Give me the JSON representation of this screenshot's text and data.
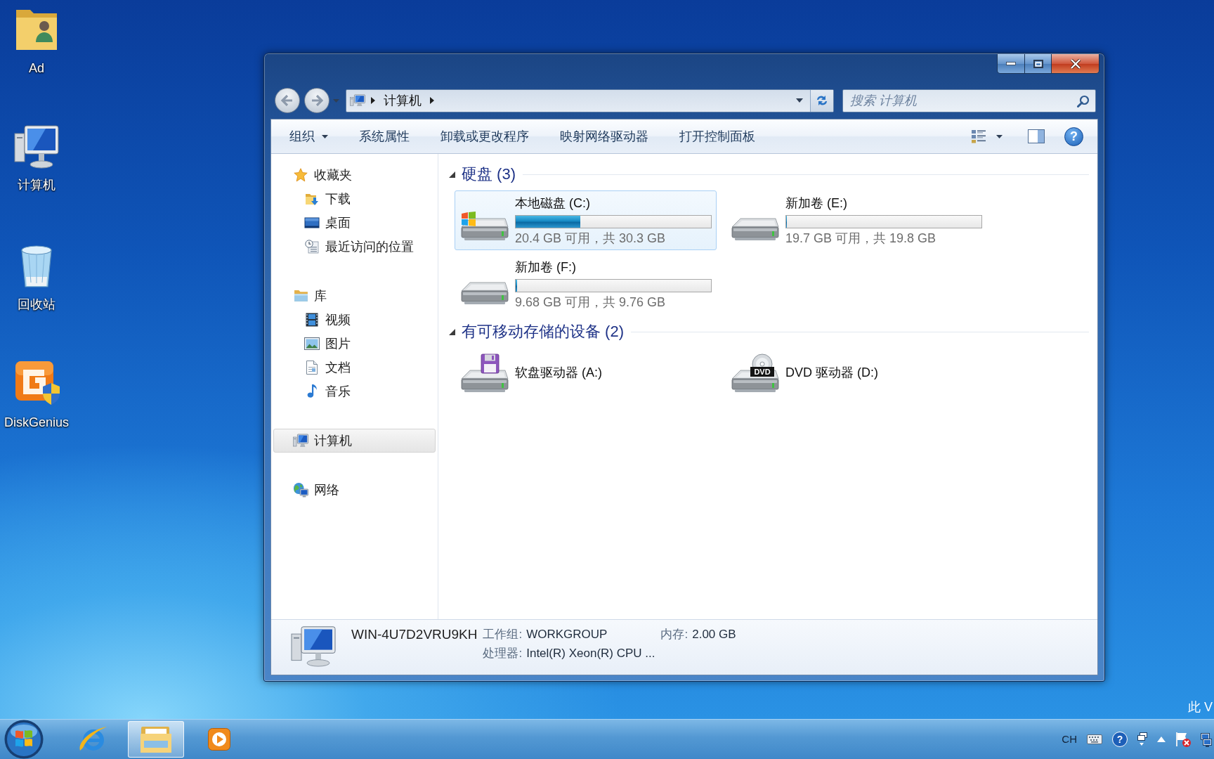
{
  "desktop": {
    "icons": [
      {
        "kind": "user-folder",
        "label": "Ad"
      },
      {
        "kind": "computer",
        "label": "计算机"
      },
      {
        "kind": "recycle-bin",
        "label": "回收站"
      },
      {
        "kind": "disk-tool",
        "label": "DiskGenius"
      }
    ],
    "corner_text": "此 V"
  },
  "window": {
    "navigation": {
      "back": {
        "disabled": true
      },
      "forward": {
        "disabled": true
      }
    },
    "address": {
      "path": [
        "计算机"
      ]
    },
    "search": {
      "placeholder": "搜索 计算机"
    }
  },
  "toolbar": {
    "items": [
      {
        "kind": "menu",
        "label": "组织"
      },
      {
        "kind": "command",
        "label": "系统属性"
      },
      {
        "kind": "command",
        "label": "卸载或更改程序"
      },
      {
        "kind": "command",
        "label": "映射网络驱动器"
      },
      {
        "kind": "command",
        "label": "打开控制面板"
      }
    ],
    "help": "?"
  },
  "sidebar": {
    "groups": [
      {
        "kind": "favorites",
        "label": "收藏夹",
        "selected": false,
        "children": [
          {
            "kind": "downloads",
            "label": "下载",
            "selected": false
          },
          {
            "kind": "desktop",
            "label": "桌面",
            "selected": false
          },
          {
            "kind": "recent",
            "label": "最近访问的位置",
            "selected": false
          }
        ]
      },
      {
        "kind": "libraries",
        "label": "库",
        "selected": false,
        "children": [
          {
            "kind": "videos",
            "label": "视频",
            "selected": false
          },
          {
            "kind": "pictures",
            "label": "图片",
            "selected": false
          },
          {
            "kind": "documents",
            "label": "文档",
            "selected": false
          },
          {
            "kind": "music",
            "label": "音乐",
            "selected": false
          }
        ]
      },
      {
        "kind": "computer",
        "label": "计算机",
        "selected": true
      },
      {
        "kind": "network",
        "label": "网络",
        "selected": false
      }
    ]
  },
  "content": {
    "groups": [
      {
        "title": "硬盘 (3)",
        "expanded": true,
        "items": [
          {
            "kind": "system-disk",
            "name": "本地磁盘 (C:)",
            "selected": true,
            "level": 0.33,
            "space": "20.4 GB 可用，共 30.3 GB"
          },
          {
            "kind": "disk",
            "name": "新加卷 (E:)",
            "selected": false,
            "level": 0.005,
            "space": "19.7 GB 可用，共 19.8 GB"
          },
          {
            "kind": "disk",
            "name": "新加卷 (F:)",
            "selected": false,
            "level": 0.008,
            "space": "9.68 GB 可用，共 9.76 GB"
          }
        ]
      },
      {
        "title": "有可移动存储的设备 (2)",
        "expanded": true,
        "items": [
          {
            "kind": "floppy",
            "name": "软盘驱动器 (A:)",
            "selected": false
          },
          {
            "kind": "dvd",
            "name": "DVD 驱动器 (D:)",
            "selected": false,
            "icon_label": "DVD"
          }
        ]
      }
    ]
  },
  "details": {
    "name": "WIN-4U7D2VRU9KH",
    "fields": [
      {
        "label": "工作组:",
        "value": "WORKGROUP"
      },
      {
        "label": "内存:",
        "value": "2.00 GB"
      },
      {
        "label": "处理器:",
        "value": "Intel(R) Xeon(R) CPU ..."
      }
    ]
  },
  "taskbar": {
    "apps": [
      {
        "kind": "browser",
        "selected": false
      },
      {
        "kind": "file-explorer",
        "selected": true
      },
      {
        "kind": "media-player",
        "selected": false
      }
    ],
    "tray": [
      {
        "kind": "text",
        "text": "CH"
      },
      {
        "kind": "keyboard"
      },
      {
        "kind": "help",
        "text": "?"
      },
      {
        "kind": "display"
      },
      {
        "kind": "show-hidden"
      },
      {
        "kind": "action-center"
      },
      {
        "kind": "network"
      }
    ]
  }
}
